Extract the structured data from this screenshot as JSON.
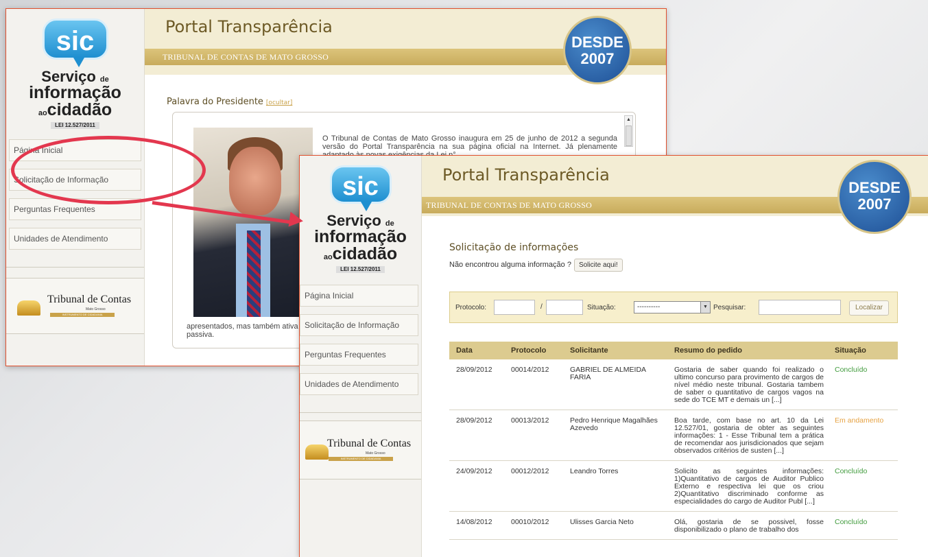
{
  "screen1": {
    "sic_logo": {
      "bubble": "sic",
      "line1": "Serviço",
      "line1_small": "de",
      "line2": "informação",
      "line3_small": "ao",
      "line3": "cidadão",
      "law": "LEI 12.527/2011"
    },
    "menu": [
      "Página Inicial",
      "Solicitação de Informação",
      "Perguntas Frequentes",
      "Unidades de Atendimento"
    ],
    "tribunal": {
      "name": "Tribunal de Contas",
      "sub": "Mato Grosso",
      "tag": "INSTRUMENTO DE CIDADANIA"
    },
    "header": {
      "title": "Portal Transparência",
      "subtitle": "TRIBUNAL DE CONTAS DE MATO GROSSO",
      "badge_top": "DESDE",
      "badge_year": "2007"
    },
    "president": {
      "title": "Palavra do Presidente",
      "hide_link": "[ocultar]",
      "text_top": "O Tribunal de Contas de Mato Grosso inaugura em 25 de junho de 2012 a segunda versão do Portal Transparência na sua página oficial na Internet. Já plenamente adaptado às novas exigências da Lei n°",
      "text_bottom": "apresentados, mas também ativa e passiva."
    }
  },
  "screen2": {
    "sic_logo": {
      "bubble": "sic",
      "line1": "Serviço",
      "line1_small": "de",
      "line2": "informação",
      "line3_small": "ao",
      "line3": "cidadão",
      "law": "LEI 12.527/2011"
    },
    "menu": [
      "Página Inicial",
      "Solicitação de Informação",
      "Perguntas Frequentes",
      "Unidades de Atendimento"
    ],
    "tribunal": {
      "name": "Tribunal de Contas",
      "sub": "Mato Grosso",
      "tag": "INSTRUMENTO DE CIDADANIA"
    },
    "header": {
      "title": "Portal Transparência",
      "subtitle": "TRIBUNAL DE CONTAS DE MATO GROSSO",
      "badge_top": "DESDE",
      "badge_year": "2007"
    },
    "section_title": "Solicitação de informações",
    "not_found": "Não encontrou alguma informação ?",
    "request_button": "Solicite aqui!",
    "search": {
      "protocol_label": "Protocolo:",
      "slash": "/",
      "status_label": "Situação:",
      "status_value": "----------",
      "search_label": "Pesquisar:",
      "locate_button": "Localizar"
    },
    "table": {
      "headers": [
        "Data",
        "Protocolo",
        "Solicitante",
        "Resumo do pedido",
        "Situação"
      ],
      "rows": [
        {
          "date": "28/09/2012",
          "protocol": "00014/2012",
          "requester": "GABRIEL DE ALMEIDA FARIA",
          "summary": "Gostaria de saber quando foi realizado o ultimo concurso para provimento de cargos de nível médio neste tribunal. Gostaria tambem de saber o quantitativo de cargos vagos na sede do TCE MT e demais un [...]",
          "status": "Concluído",
          "status_kind": "done"
        },
        {
          "date": "28/09/2012",
          "protocol": "00013/2012",
          "requester": "Pedro Henrique Magalhães Azevedo",
          "summary": "Boa tarde, com base no art. 10 da Lei 12.527/01, gostaria de obter as seguintes informações: 1 - Esse Tribunal tem a prática de recomendar aos jurisdicionados que sejam observados critérios de susten [...]",
          "status": "Em andamento",
          "status_kind": "progress"
        },
        {
          "date": "24/09/2012",
          "protocol": "00012/2012",
          "requester": "Leandro Torres",
          "summary": "Solicito as seguintes informações: 1)Quantitativo de cargos de Auditor Publico Externo e respectiva lei que os criou 2)Quantitativo discriminado conforme as especialidades do cargo de Auditor Publ [...]",
          "status": "Concluído",
          "status_kind": "done"
        },
        {
          "date": "14/08/2012",
          "protocol": "00010/2012",
          "requester": "Ulisses Garcia Neto",
          "summary": "Olá, gostaria de se possivel, fosse disponibilizado o plano de trabalho dos",
          "status": "Concluído",
          "status_kind": "done"
        }
      ]
    }
  },
  "colors": {
    "highlight": "#e3374e",
    "header_gold": "#c8ab5c",
    "badge_blue": "#1e4f95",
    "status_done": "#3f9a3b",
    "status_progress": "#e6a243"
  }
}
